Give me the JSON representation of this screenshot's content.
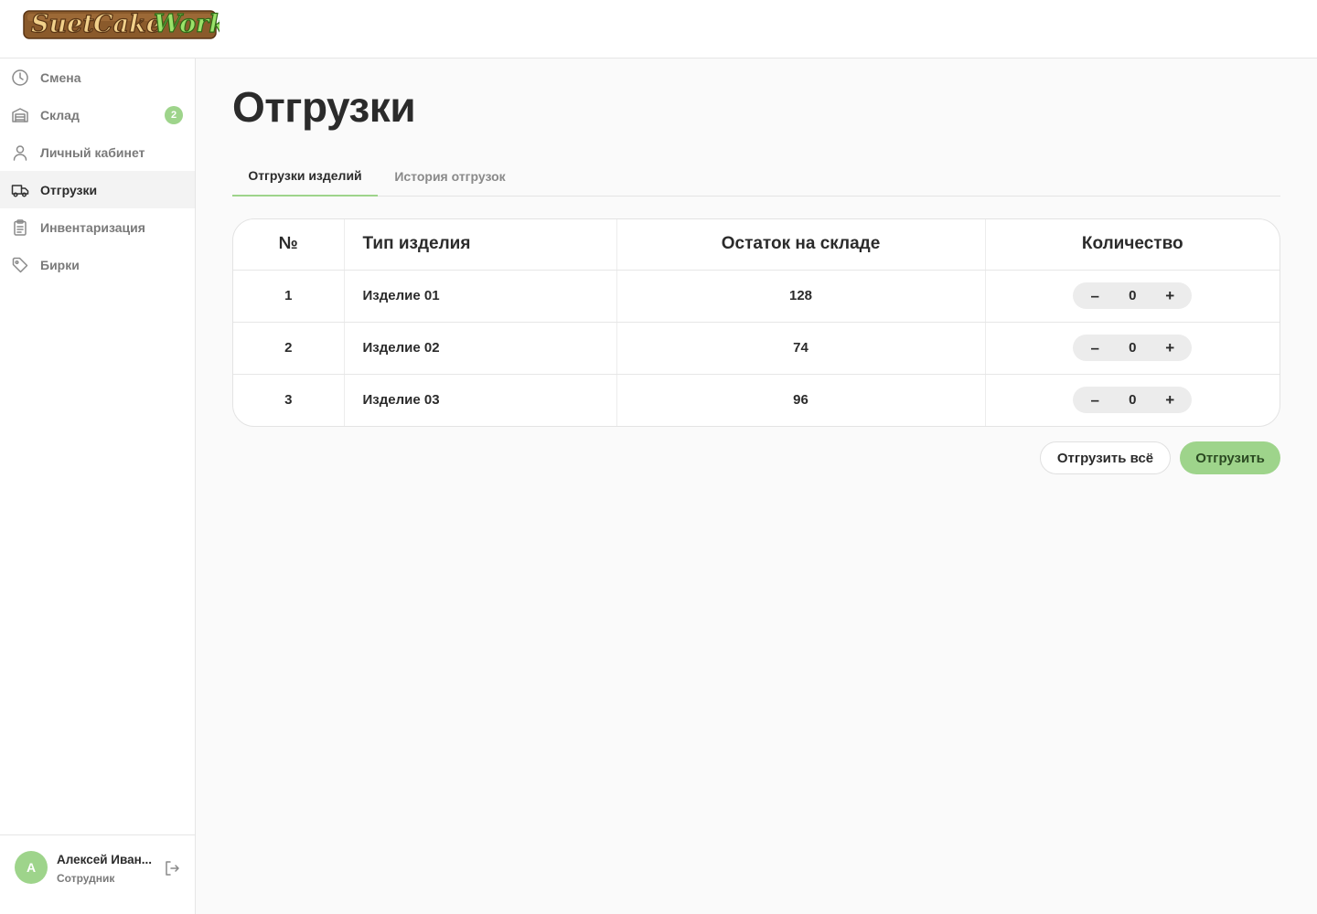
{
  "brand": {
    "logo_words": [
      "Suet",
      "Cake",
      "Work"
    ],
    "colors": {
      "accent": "#9ed48b",
      "logo_brown": "#7a4a1e",
      "logo_green": "#5aa83a"
    }
  },
  "sidebar": {
    "items": [
      {
        "label": "Смена",
        "icon": "clock-icon",
        "active": false
      },
      {
        "label": "Склад",
        "icon": "warehouse-icon",
        "active": false,
        "badge": "2"
      },
      {
        "label": "Личный кабинет",
        "icon": "user-icon",
        "active": false
      },
      {
        "label": "Отгрузки",
        "icon": "truck-icon",
        "active": true
      },
      {
        "label": "Инвентаризация",
        "icon": "clipboard-icon",
        "active": false
      },
      {
        "label": "Бирки",
        "icon": "tag-icon",
        "active": false
      }
    ],
    "user": {
      "initial": "А",
      "name": "Алексей Иван...",
      "role": "Сотрудник"
    }
  },
  "main": {
    "title": "Отгрузки",
    "tabs": [
      {
        "label": "Отгрузки изделий",
        "active": true
      },
      {
        "label": "История отгрузок",
        "active": false
      }
    ],
    "table": {
      "headers": [
        "№",
        "Тип изделия",
        "Остаток на складе",
        "Количество"
      ],
      "rows": [
        {
          "num": "1",
          "type": "Изделие 01",
          "stock": "128",
          "qty": "0"
        },
        {
          "num": "2",
          "type": "Изделие 02",
          "stock": "74",
          "qty": "0"
        },
        {
          "num": "3",
          "type": "Изделие 03",
          "stock": "96",
          "qty": "0"
        }
      ],
      "minus": "–",
      "plus": "+"
    },
    "actions": {
      "ship_all": "Отгрузить всё",
      "ship": "Отгрузить"
    }
  }
}
